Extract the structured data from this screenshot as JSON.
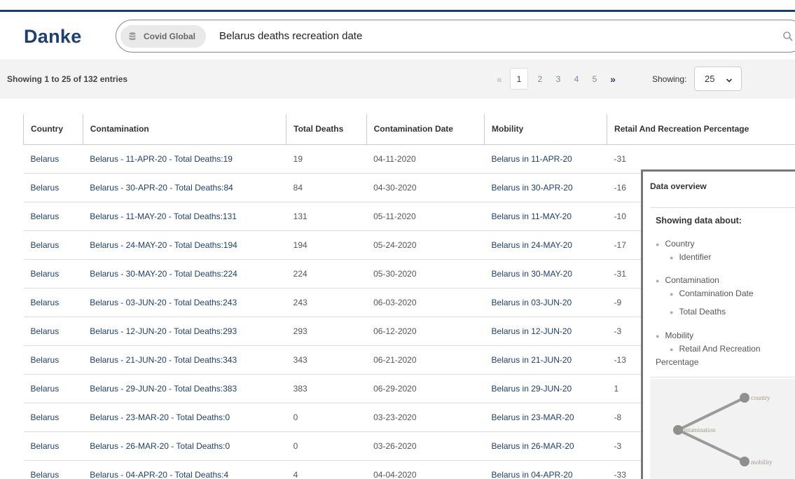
{
  "app": {
    "logo": "Danke"
  },
  "search": {
    "dataset": "Covid Global",
    "query": "Belarus deaths recreation date"
  },
  "toolbar": {
    "entries_text": "Showing 1 to 25 of 132 entries",
    "pages": [
      "1",
      "2",
      "3",
      "4",
      "5"
    ],
    "prev_label": "«",
    "next_label": "»",
    "showing_label": "Showing:",
    "page_size": "25"
  },
  "table": {
    "headers": [
      "Country",
      "Contamination",
      "Total Deaths",
      "Contamination Date",
      "Mobility",
      "Retail And Recreation Percentage"
    ],
    "rows": [
      [
        "Belarus",
        "Belarus - 11-APR-20 - Total Deaths:19",
        "19",
        "04-11-2020",
        "Belarus in 11-APR-20",
        "-31"
      ],
      [
        "Belarus",
        "Belarus - 30-APR-20 - Total Deaths:84",
        "84",
        "04-30-2020",
        "Belarus in 30-APR-20",
        "-16"
      ],
      [
        "Belarus",
        "Belarus - 11-MAY-20 - Total Deaths:131",
        "131",
        "05-11-2020",
        "Belarus in 11-MAY-20",
        "-10"
      ],
      [
        "Belarus",
        "Belarus - 24-MAY-20 - Total Deaths:194",
        "194",
        "05-24-2020",
        "Belarus in 24-MAY-20",
        "-17"
      ],
      [
        "Belarus",
        "Belarus - 30-MAY-20 - Total Deaths:224",
        "224",
        "05-30-2020",
        "Belarus in 30-MAY-20",
        "-31"
      ],
      [
        "Belarus",
        "Belarus - 03-JUN-20 - Total Deaths:243",
        "243",
        "06-03-2020",
        "Belarus in 03-JUN-20",
        "-9"
      ],
      [
        "Belarus",
        "Belarus - 12-JUN-20 - Total Deaths:293",
        "293",
        "06-12-2020",
        "Belarus in 12-JUN-20",
        "-3"
      ],
      [
        "Belarus",
        "Belarus - 21-JUN-20 - Total Deaths:343",
        "343",
        "06-21-2020",
        "Belarus in 21-JUN-20",
        "-13"
      ],
      [
        "Belarus",
        "Belarus - 29-JUN-20 - Total Deaths:383",
        "383",
        "06-29-2020",
        "Belarus in 29-JUN-20",
        "1"
      ],
      [
        "Belarus",
        "Belarus - 23-MAR-20 - Total Deaths:0",
        "0",
        "03-23-2020",
        "Belarus in 23-MAR-20",
        "-8"
      ],
      [
        "Belarus",
        "Belarus - 26-MAR-20 - Total Deaths:0",
        "0",
        "03-26-2020",
        "Belarus in 26-MAR-20",
        "-3"
      ],
      [
        "Belarus",
        "Belarus - 04-APR-20 - Total Deaths:4",
        "4",
        "04-04-2020",
        "Belarus in 04-APR-20",
        "-33"
      ]
    ]
  },
  "overview": {
    "title": "Data overview",
    "subtitle": "Showing data about:",
    "country": "Country",
    "identifier": "Identifier",
    "contamination": "Contamination",
    "contamination_date": "Contamination Date",
    "total_deaths": "Total Deaths",
    "mobility": "Mobility",
    "retail_line1": "Retail And Recreation",
    "retail_line2": "Percentage",
    "graph": {
      "node_country": "country",
      "node_contamination": "contamination",
      "node_mobility": "mobility"
    }
  },
  "colors": {
    "brand": "#1d3f72",
    "link": "#1d3f72",
    "topbar": "#1c3d6e"
  },
  "icons": {
    "dataset": "database-icon",
    "search": "search-icon",
    "dropdown": "chevron-down-icon"
  }
}
